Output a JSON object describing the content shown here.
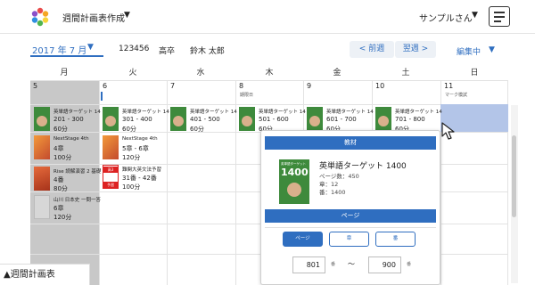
{
  "header": {
    "app_title": "週間計画表作成",
    "app_caret": "▼",
    "user_name": "サンプルさん",
    "user_caret": "▼",
    "icons": {
      "logo": "flower-logo-icon",
      "menu": "hamburger-menu-icon"
    }
  },
  "toolbar": {
    "month": "2017 年 7 月",
    "month_caret": "▼",
    "student_id": "123456",
    "grade": "高卒",
    "student_name": "鈴木 太郎",
    "prev_week": "< 前週",
    "next_week": "翌週 >",
    "mode": "編集中",
    "mode_caret": "▼"
  },
  "calendar": {
    "weekdays": [
      "月",
      "火",
      "水",
      "木",
      "金",
      "土",
      "日"
    ],
    "dates": [
      "5",
      "6",
      "7",
      "8",
      "9",
      "10",
      "11"
    ],
    "events": {
      "thu": "期限日",
      "sun": "マーク模試"
    },
    "cells": {
      "mon": [
        {
          "title": "英単語ターゲット 14",
          "range": "201 - 300",
          "time": "60分"
        },
        {
          "title": "NextStage 4th",
          "range": "4章",
          "time": "100分"
        },
        {
          "title": "Rise 読解演習 2 基礎",
          "range": "4番",
          "time": "80分"
        },
        {
          "title": "山川 日本史 一問一答",
          "range": "6章",
          "time": "120分"
        }
      ],
      "tue": [
        {
          "title": "英単語ターゲット 14",
          "range": "301 - 400",
          "time": "60分"
        },
        {
          "title": "NextStage 4th",
          "range": "5章 - 6章",
          "time": "120分"
        },
        {
          "title": "難関大英文法予習",
          "range": "31番 - 42番",
          "time": "100分",
          "badge": "高3 難関大 英文法 予習"
        }
      ],
      "wed": [
        {
          "title": "英単語ターゲット 14",
          "range": "401 - 500",
          "time": "60分"
        }
      ],
      "thu": [
        {
          "title": "英単語ターゲット 14",
          "range": "501 - 600",
          "time": "60分"
        }
      ],
      "fri": [
        {
          "title": "英単語ターゲット 14",
          "range": "601 - 700",
          "time": "60分"
        }
      ],
      "sat": [
        {
          "title": "英単語ターゲット 14",
          "range": "701 - 800",
          "time": "60分"
        }
      ]
    }
  },
  "popup": {
    "section_material": "教材",
    "cover_label": "英単語ターゲット",
    "cover_number": "1400",
    "title": "英単語ターゲット 1400",
    "pages_label": "ページ数：450",
    "chapters_label": "章：12",
    "numbers_label": "番：1400",
    "section_page": "ページ",
    "tabs": [
      "ページ",
      "章",
      "番"
    ],
    "page_from": "801",
    "page_to": "900",
    "suffix": "番",
    "tilde": "～"
  },
  "caption": "▲週間計画表"
}
